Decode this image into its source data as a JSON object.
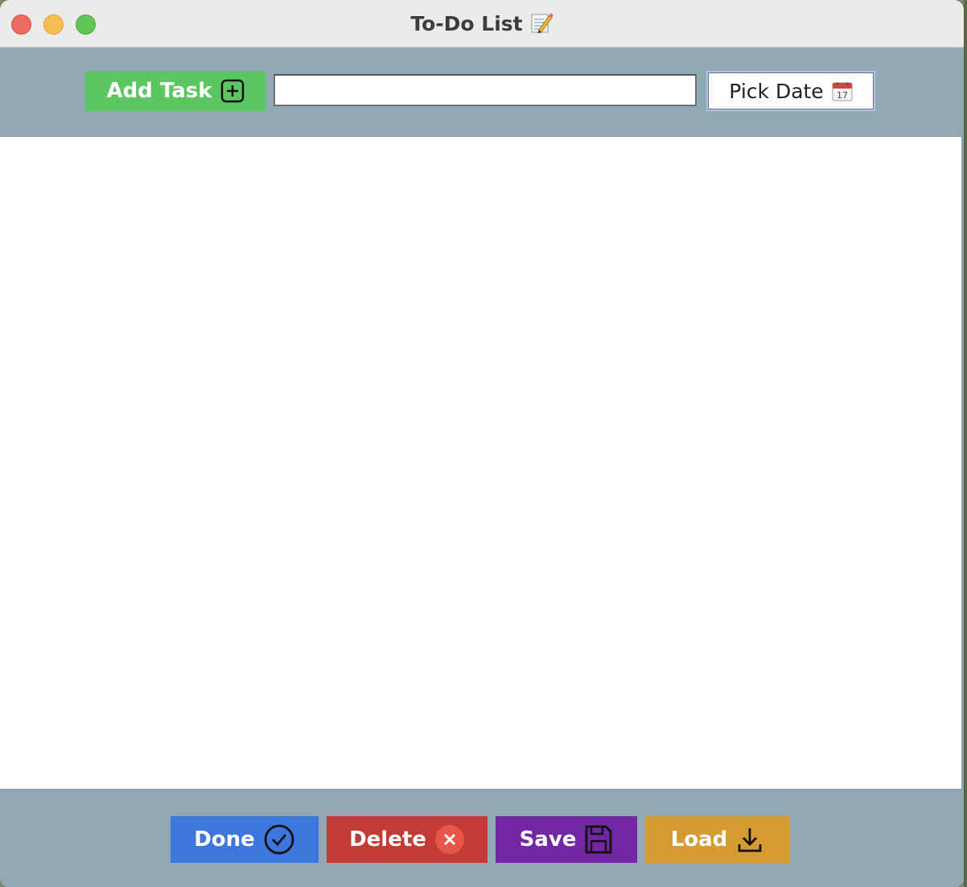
{
  "window": {
    "title": "To-Do List",
    "title_icon": "memo-pencil-icon"
  },
  "toolbar": {
    "add_task_label": "Add Task",
    "add_task_icon": "plus-square-icon",
    "task_input_value": "",
    "task_input_placeholder": "",
    "pick_date_label": "Pick Date",
    "pick_date_icon": "calendar-icon",
    "calendar_day": "17"
  },
  "task_list": {
    "items": []
  },
  "actions": {
    "done_label": "Done",
    "done_icon": "check-circle-icon",
    "delete_label": "Delete",
    "delete_icon": "close-circle-icon",
    "save_label": "Save",
    "save_icon": "floppy-disk-icon",
    "load_label": "Load",
    "load_icon": "download-icon"
  },
  "colors": {
    "background": "#91a9b3",
    "add_task": "#5cc660",
    "done": "#3d76dc",
    "delete": "#c23b34",
    "save": "#7228a2",
    "load": "#d69a32"
  }
}
